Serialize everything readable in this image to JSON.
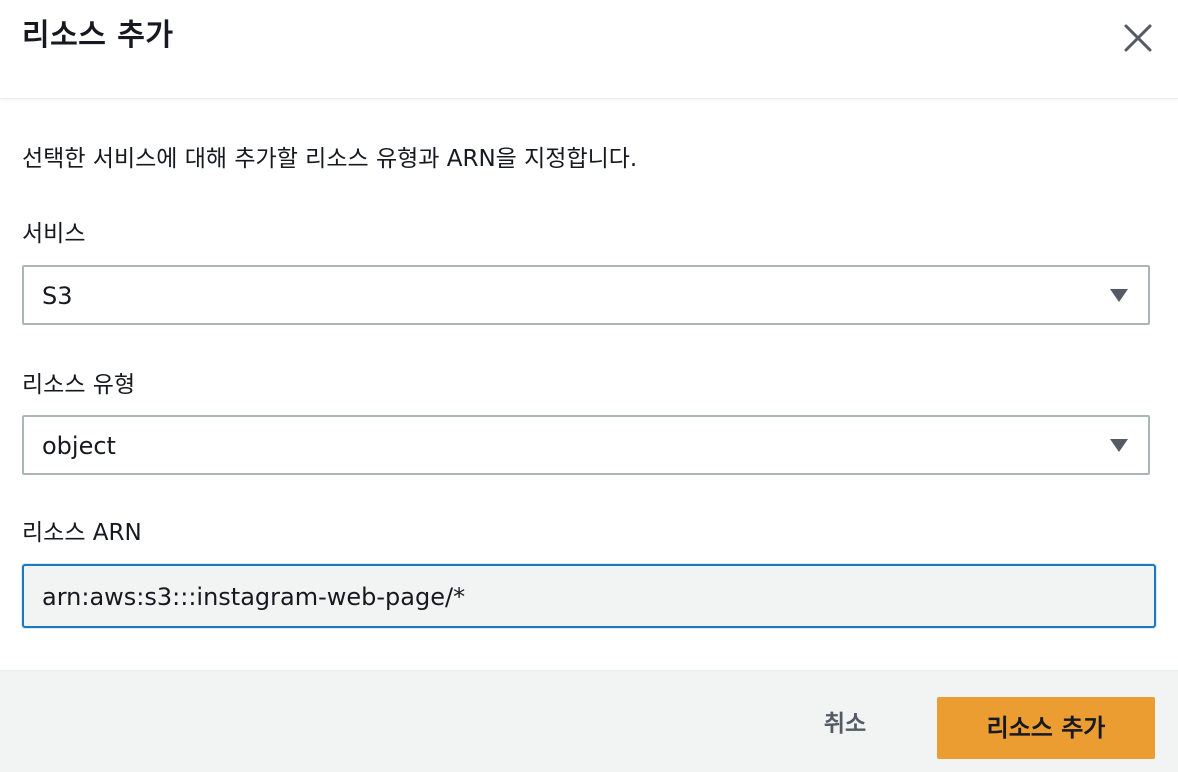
{
  "modal": {
    "title": "리소스 추가",
    "description": "선택한 서비스에 대해 추가할 리소스 유형과 ARN을 지정합니다."
  },
  "fields": {
    "service": {
      "label": "서비스",
      "value": "S3"
    },
    "resource_type": {
      "label": "리소스 유형",
      "value": "object"
    },
    "resource_arn": {
      "label": "리소스 ARN",
      "value": "arn:aws:s3:::instagram-web-page/*"
    }
  },
  "footer": {
    "cancel_label": "취소",
    "submit_label": "리소스 추가"
  },
  "icons": {
    "close": "close-icon",
    "dropdown": "caret-down-icon"
  },
  "colors": {
    "primary_button": "#ec9d32",
    "focus_border": "#1f77bd",
    "select_border": "#aab7b8"
  }
}
